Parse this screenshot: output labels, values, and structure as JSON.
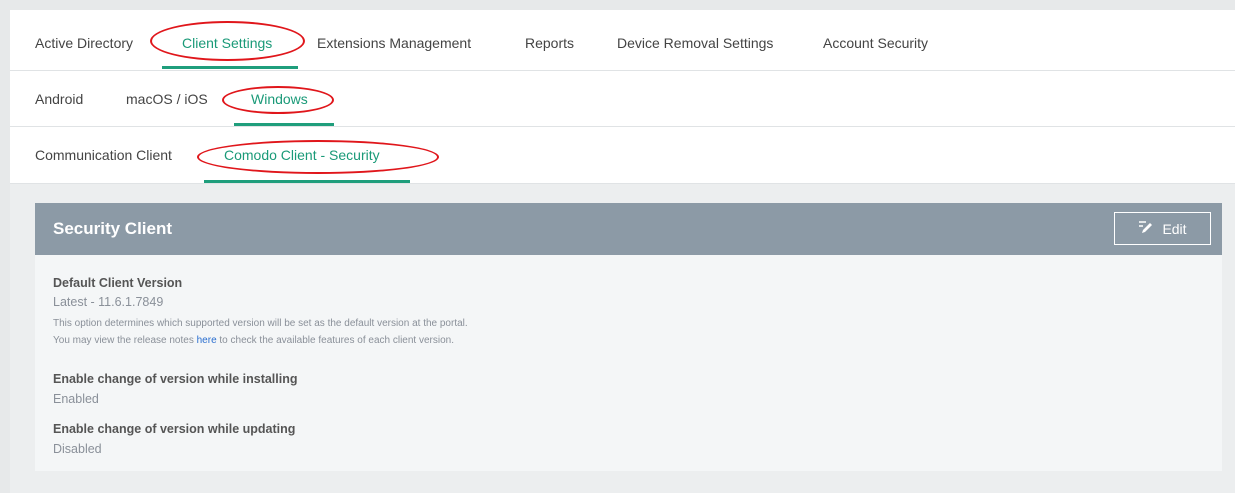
{
  "top_tabs": {
    "items": [
      "Active Directory",
      "Client Settings",
      "Extensions Management",
      "Reports",
      "Device Removal Settings",
      "Account Security"
    ],
    "active": "Client Settings"
  },
  "os_tabs": {
    "items": [
      "Android",
      "macOS / iOS",
      "Windows"
    ],
    "active": "Windows"
  },
  "client_tabs": {
    "items": [
      "Communication Client",
      "Comodo Client - Security"
    ],
    "active": "Comodo Client - Security"
  },
  "panel": {
    "title": "Security Client",
    "edit_label": "Edit",
    "default_version": {
      "label": "Default Client Version",
      "value": "Latest - 11.6.1.7849",
      "note1": "This option determines which supported version will be set as the default version at the portal.",
      "note2_pre": "You may view the release notes ",
      "note2_link": "here",
      "note2_post": " to check the available features of each client version."
    },
    "change_installing": {
      "label": "Enable change of version while installing",
      "value": "Enabled"
    },
    "change_updating": {
      "label": "Enable change of version while updating",
      "value": "Disabled"
    }
  },
  "colors": {
    "accent": "#1f9e7c",
    "annotation": "#e0161b",
    "panel_header": "#8c9aa6"
  }
}
